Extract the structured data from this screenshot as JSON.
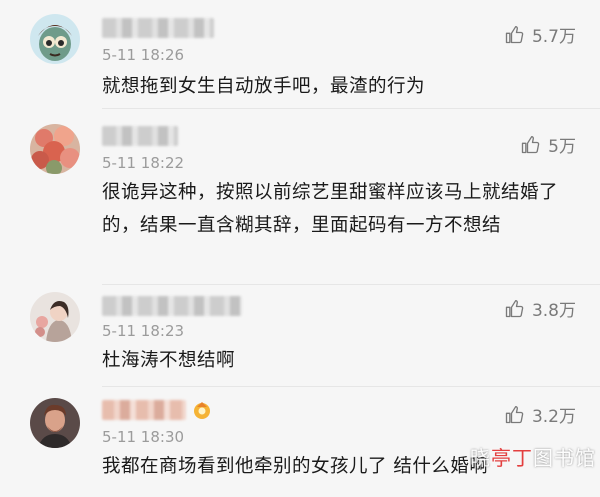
{
  "comments": [
    {
      "time": "5-11 18:26",
      "text": "就想拖到女生自动放手吧，最渣的行为",
      "likes": "5.7万",
      "avatar_icon": "cartoon-avatar-icon"
    },
    {
      "time": "5-11 18:22",
      "text": "很诡异这种，按照以前综艺里甜蜜样应该马上就结婚了的，结果一直含糊其辞，里面起码有一方不想结",
      "likes": "5万",
      "avatar_icon": "flowers-avatar-icon"
    },
    {
      "time": "5-11 18:23",
      "text": "杜海涛不想结啊",
      "likes": "3.8万",
      "avatar_icon": "girl-avatar-icon"
    },
    {
      "time": "5-11 18:30",
      "text": "我都在商场看到他牵别的女孩儿了 结什么婚啊",
      "likes": "3.2万",
      "avatar_icon": "man-avatar-icon"
    }
  ],
  "watermark": {
    "text_white": "晓",
    "text_red": "亭丁",
    "text_white2": "图书馆"
  },
  "colors": {
    "background": "#f6f6f6",
    "text": "#1a1a1a",
    "meta": "#9b9b9b"
  }
}
